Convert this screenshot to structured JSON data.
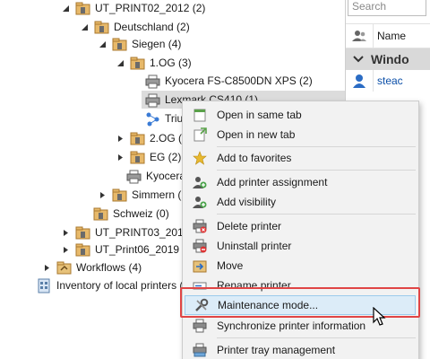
{
  "tree": {
    "items": [
      {
        "label": "UT_PRINT02_2012 (2)",
        "icon": "building-folder-icon"
      },
      {
        "label": "Deutschland (2)",
        "icon": "building-folder-icon"
      },
      {
        "label": "Siegen (4)",
        "icon": "building-folder-icon"
      },
      {
        "label": "1.OG (3)",
        "icon": "building-folder-icon"
      },
      {
        "label": "Kyocera FS-C8500DN XPS (2)",
        "icon": "printer-icon"
      },
      {
        "label": "Lexmark CS410 (1)",
        "icon": "printer-icon"
      },
      {
        "label": "Triun",
        "icon": "network-printer-icon"
      },
      {
        "label": "2.OG (2)",
        "icon": "building-folder-icon"
      },
      {
        "label": "EG (2)",
        "icon": "building-folder-icon"
      },
      {
        "label": "Kyocera",
        "icon": "printer-icon"
      },
      {
        "label": "Simmern (2)",
        "icon": "building-folder-icon"
      },
      {
        "label": "Schweiz (0)",
        "icon": "building-folder-icon"
      },
      {
        "label": "UT_PRINT03_2012 (2)",
        "icon": "building-folder-icon"
      },
      {
        "label": "UT_Print06_2019 (1)",
        "icon": "building-folder-icon"
      },
      {
        "label": "Workflows (4)",
        "icon": "workflow-folder-icon"
      },
      {
        "label": "Inventory of local printers (",
        "icon": "inventory-icon"
      }
    ]
  },
  "right_panel": {
    "search_placeholder": "Search",
    "column_header": "Name",
    "group_label": "Windo",
    "row_label": "steac"
  },
  "context_menu": {
    "items": [
      {
        "label": "Open in same tab",
        "icon": "open-tab-icon"
      },
      {
        "label": "Open in new tab",
        "icon": "new-tab-icon"
      },
      {
        "label": "Add to favorites",
        "icon": "star-icon"
      },
      {
        "label": "Add printer assignment",
        "icon": "user-add-icon"
      },
      {
        "label": "Add visibility",
        "icon": "visibility-icon"
      },
      {
        "label": "Delete printer",
        "icon": "delete-printer-icon"
      },
      {
        "label": "Uninstall printer",
        "icon": "uninstall-printer-icon"
      },
      {
        "label": "Move",
        "icon": "move-icon"
      },
      {
        "label": "Rename printer",
        "icon": "rename-icon"
      },
      {
        "label": "Maintenance mode...",
        "icon": "wrench-icon"
      },
      {
        "label": "Synchronize printer information",
        "icon": "sync-icon"
      },
      {
        "label": "Printer tray management",
        "icon": "tray-icon"
      }
    ],
    "highlighted_index": 9
  },
  "colors": {
    "highlight_bg": "#dcecf8",
    "highlight_border": "#9ccbec",
    "annotation_red": "#e04545",
    "selected_row": "#dcdcdc"
  }
}
